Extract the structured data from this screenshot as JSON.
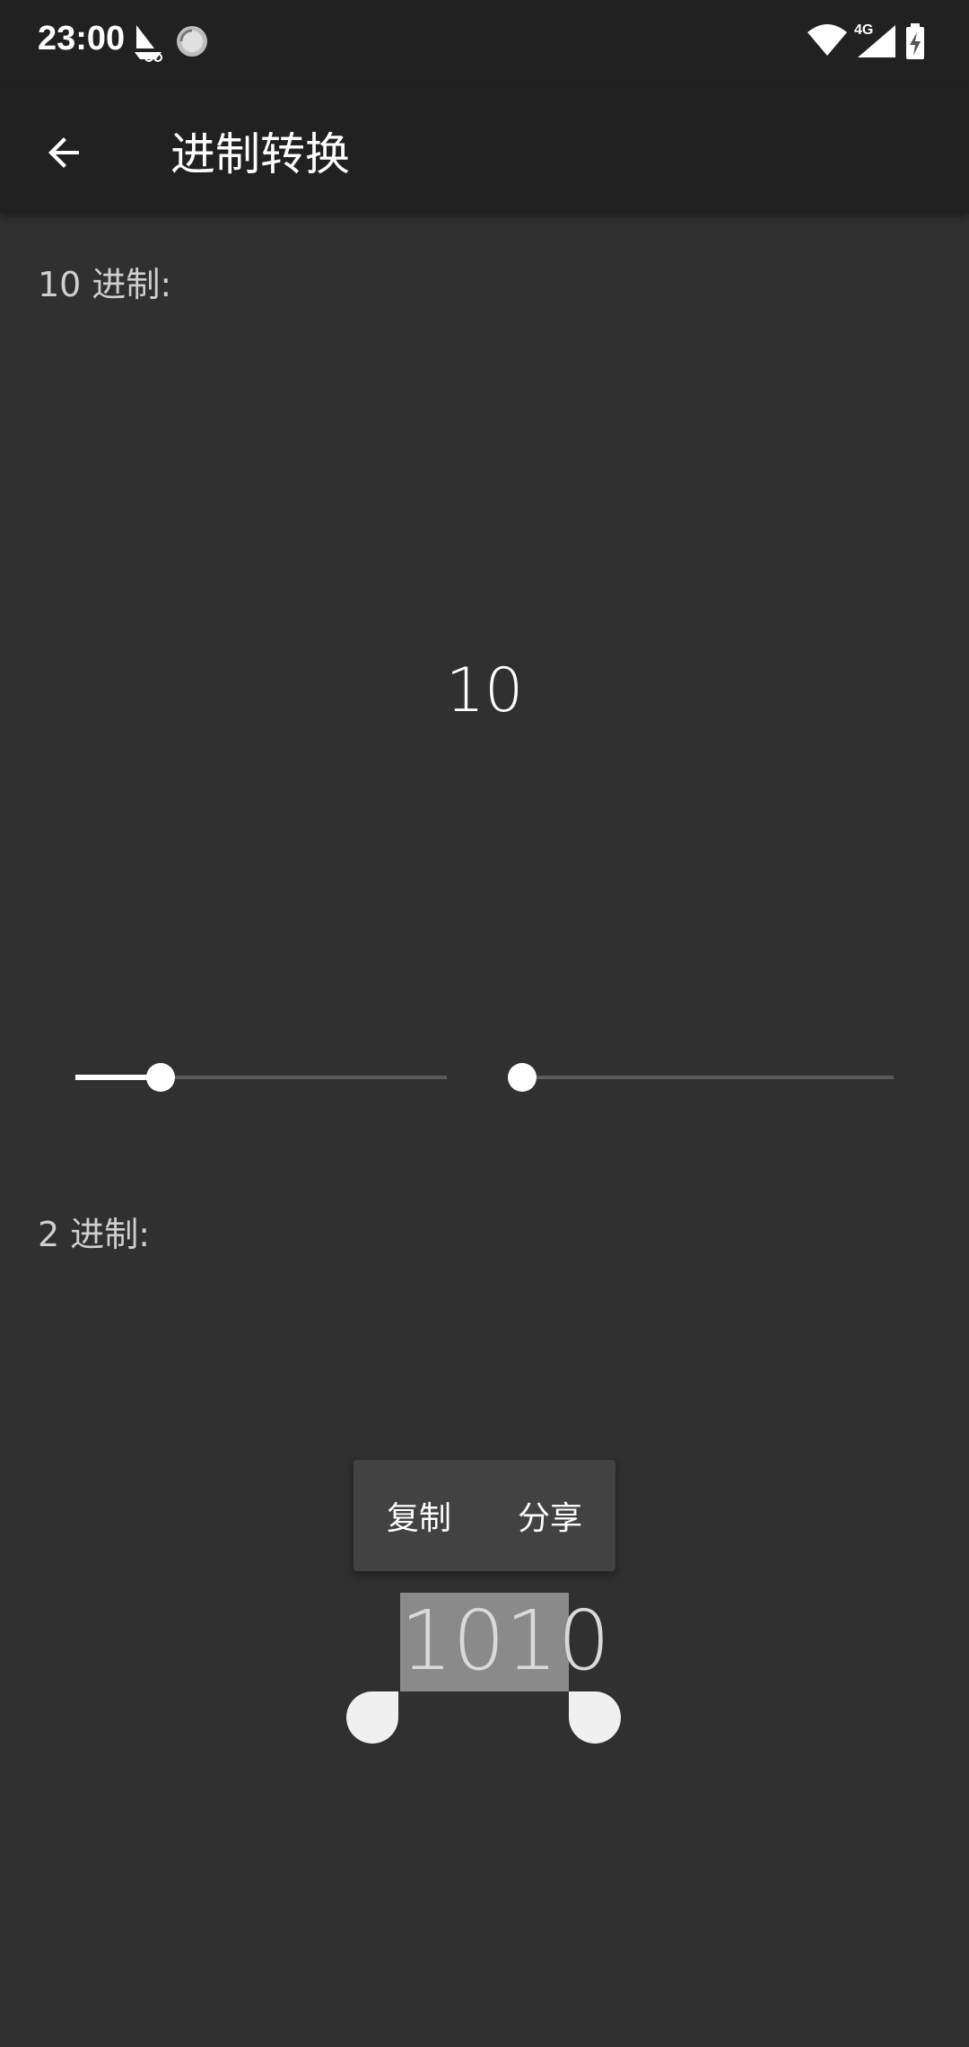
{
  "status_bar": {
    "time": "23:00",
    "left_icons": [
      "sailboat-icon",
      "sync-icon"
    ],
    "right_icons": [
      "wifi-icon",
      "cellular-4g-icon",
      "battery-charging-icon"
    ],
    "network_label": "4G"
  },
  "app_bar": {
    "title": "进制转换",
    "back_icon": "arrow-back-icon"
  },
  "source": {
    "label": "10 进制:",
    "value": "10"
  },
  "sliders": [
    {
      "name": "source-base-slider",
      "value_fraction": 0.23
    },
    {
      "name": "target-base-slider",
      "value_fraction": 0.0
    }
  ],
  "target": {
    "label": "2 进制:",
    "value": "1010"
  },
  "selection_popup": {
    "copy_label": "复制",
    "share_label": "分享"
  },
  "colors": {
    "background": "#303030",
    "app_bar": "#212121",
    "accent": "#ffffff",
    "selection": "#8a8a8a"
  }
}
